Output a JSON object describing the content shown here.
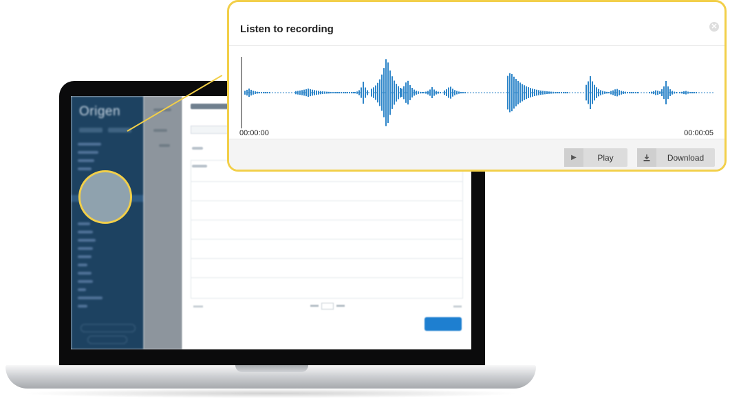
{
  "popup": {
    "title": "Listen to recording",
    "time_start": "00:00:00",
    "time_end": "00:00:05",
    "play_label": "Play",
    "download_label": "Download",
    "waveform_color": "#2f86c9",
    "accent_color": "#f2cf49",
    "icons": {
      "close": "close-circle-icon",
      "play": "play-triangle-icon",
      "download": "download-tray-icon"
    }
  },
  "background_app": {
    "logo": "Origen",
    "sidebar_color": "#1d4261",
    "primary_button_color": "#1e7fd0"
  }
}
